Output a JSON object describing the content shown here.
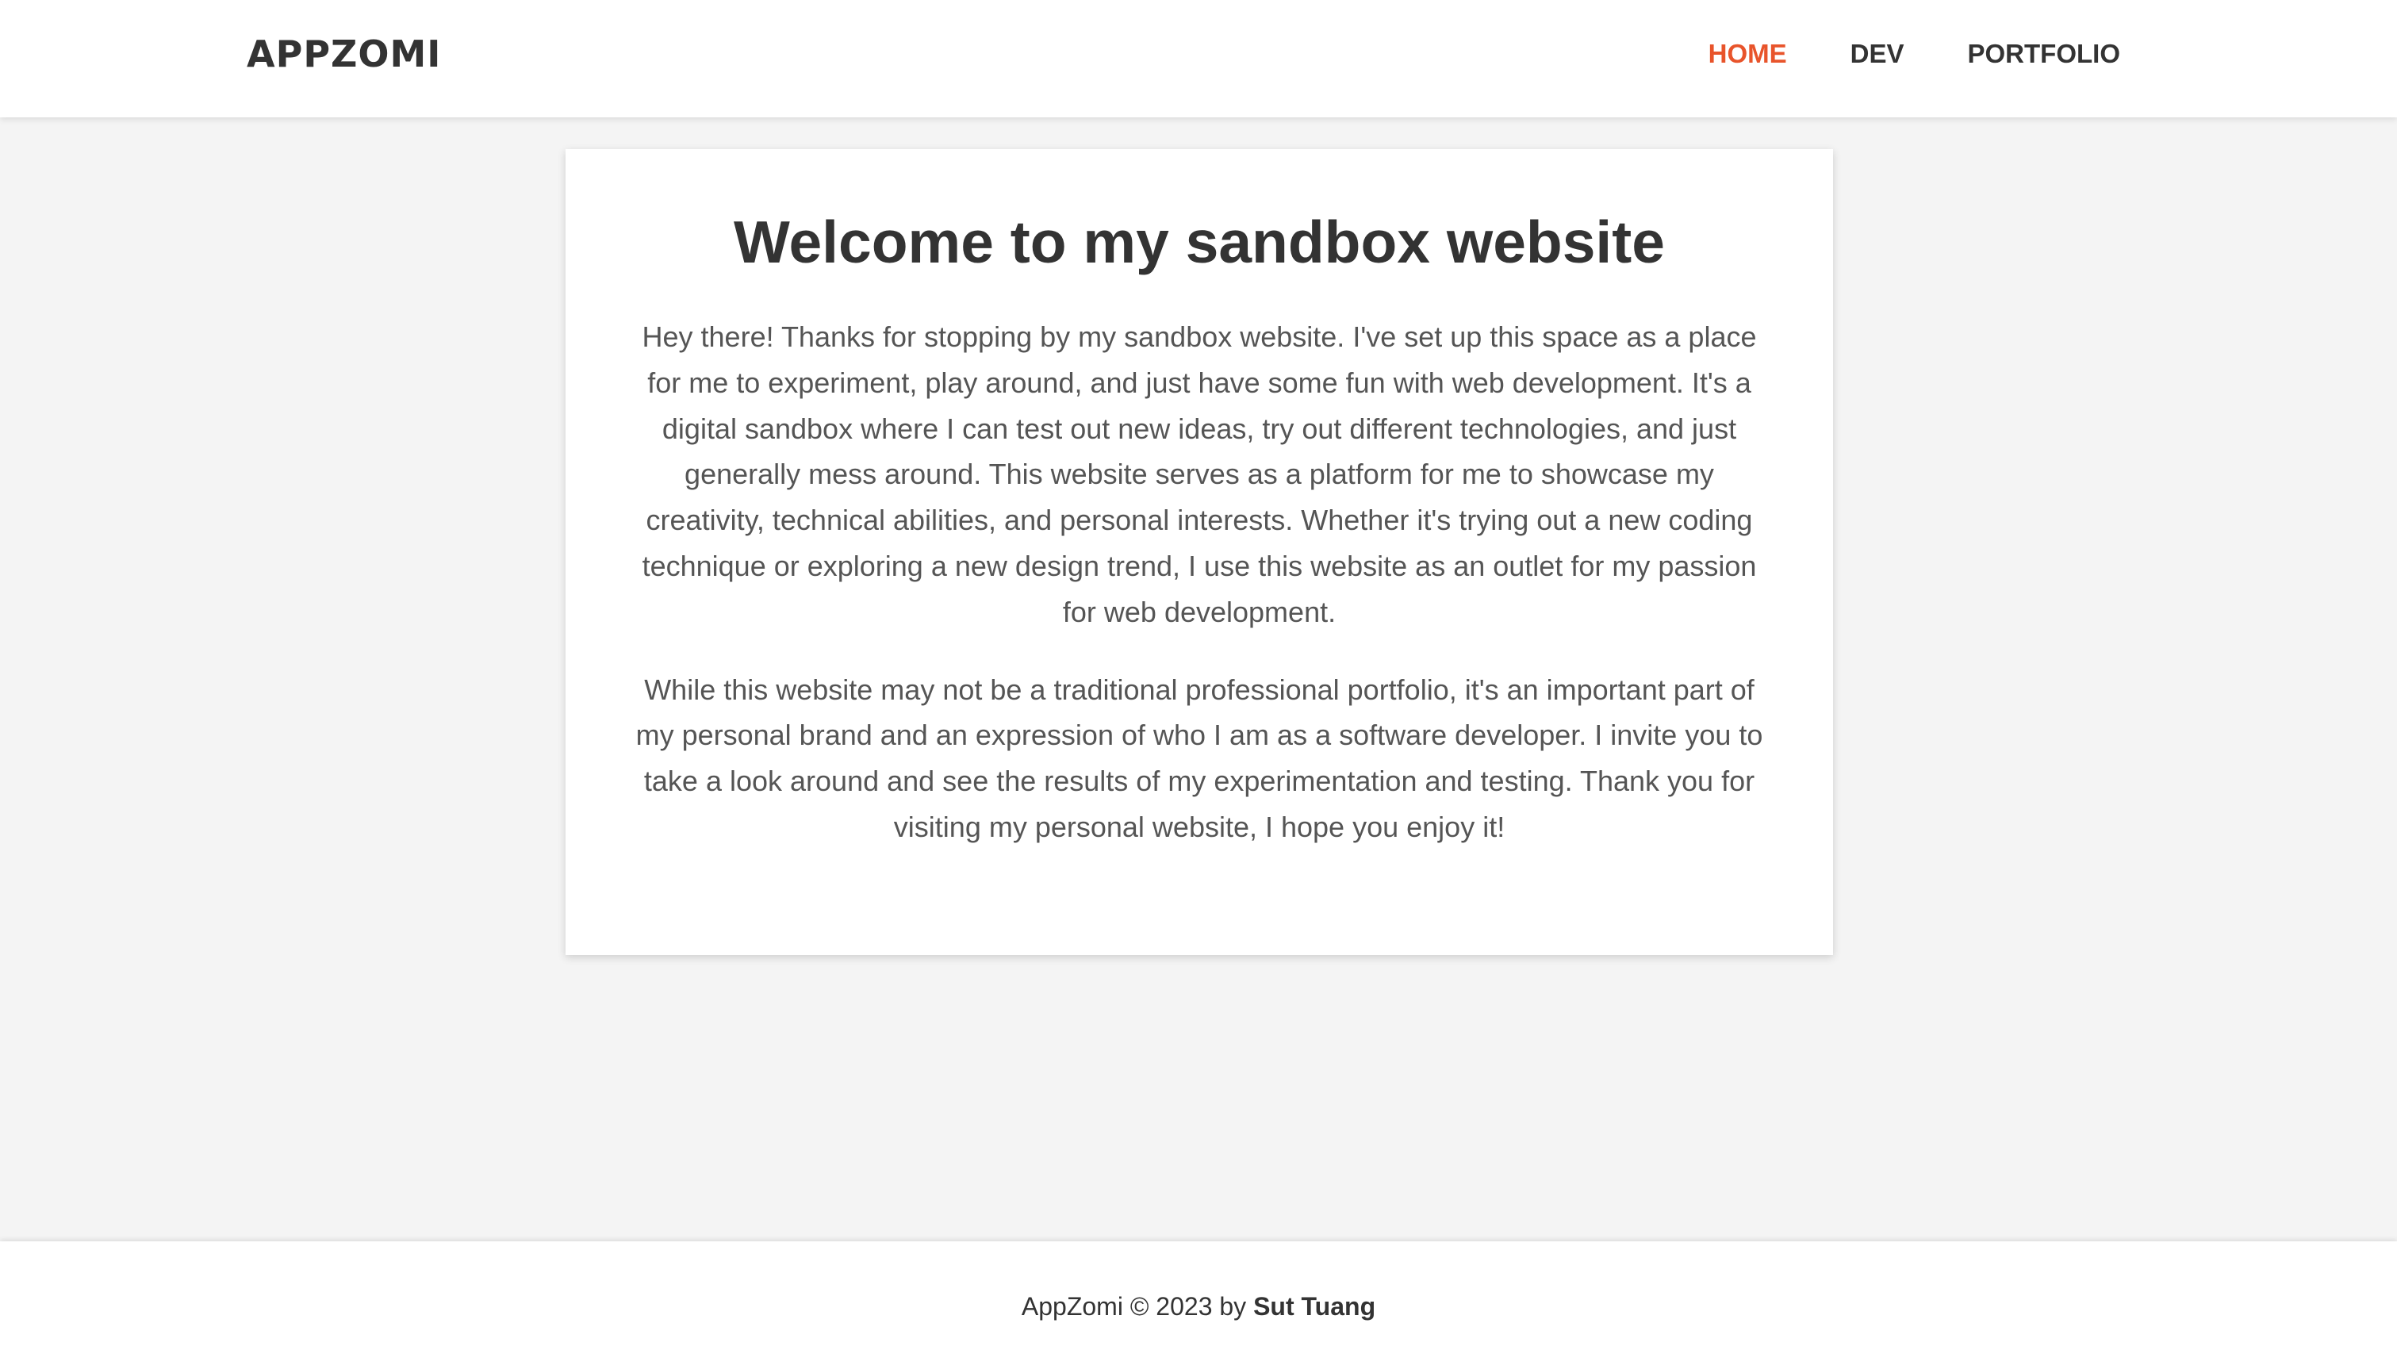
{
  "header": {
    "brand": "APPZOMI",
    "nav": [
      {
        "label": "HOME",
        "active": true
      },
      {
        "label": "DEV",
        "active": false
      },
      {
        "label": "PORTFOLIO",
        "active": false
      }
    ]
  },
  "main": {
    "title": "Welcome to my sandbox website",
    "paragraphs": [
      "Hey there! Thanks for stopping by my sandbox website. I've set up this space as a place for me to experiment, play around, and just have some fun with web development. It's a digital sandbox where I can test out new ideas, try out different technologies, and just generally mess around. This website serves as a platform for me to showcase my creativity, technical abilities, and personal interests. Whether it's trying out a new coding technique or exploring a new design trend, I use this website as an outlet for my passion for web development.",
      "While this website may not be a traditional professional portfolio, it's an important part of my personal brand and an expression of who I am as a software developer. I invite you to take a look around and see the results of my experimentation and testing. Thank you for visiting my personal website, I hope you enjoy it!"
    ]
  },
  "footer": {
    "prefix": "AppZomi © 2023 by ",
    "author": "Sut Tuang"
  },
  "colors": {
    "accent": "#e8542b",
    "text": "#333333",
    "body_text": "#555555",
    "background": "#f4f4f4"
  }
}
